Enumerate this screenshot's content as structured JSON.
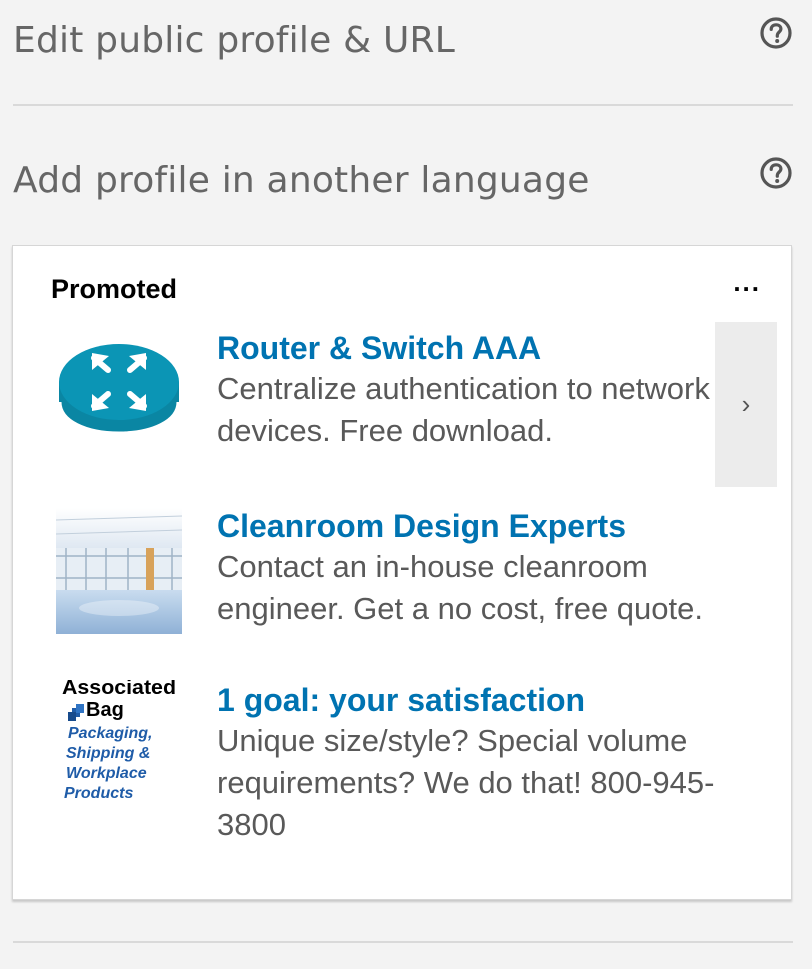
{
  "settings": {
    "edit_profile_label": "Edit public profile & URL",
    "add_language_label": "Add profile in another language"
  },
  "promo": {
    "label": "Promoted",
    "more_label": "...",
    "next_label": "›",
    "ads": [
      {
        "title": "Router & Switch AAA",
        "description": "Centralize authentication to network devices. Free download.",
        "thumb": "router-icon"
      },
      {
        "title": "Cleanroom Design Experts",
        "description": "Contact an in-house cleanroom engineer. Get a no cost, free quote.",
        "thumb": "cleanroom-photo"
      },
      {
        "title": "1 goal: your satisfaction",
        "description": "Unique size/style? Special volume requirements? We do that! 800-945-3800",
        "thumb": "associated-bag-logo",
        "logo_text": {
          "brand": "Associated Bag",
          "tagline": "Packaging, Shipping & Workplace Products"
        }
      }
    ]
  },
  "colors": {
    "link": "#0073b1",
    "muted_text": "#595959",
    "heading_text": "#666666",
    "router_teal": "#0b95b5"
  }
}
